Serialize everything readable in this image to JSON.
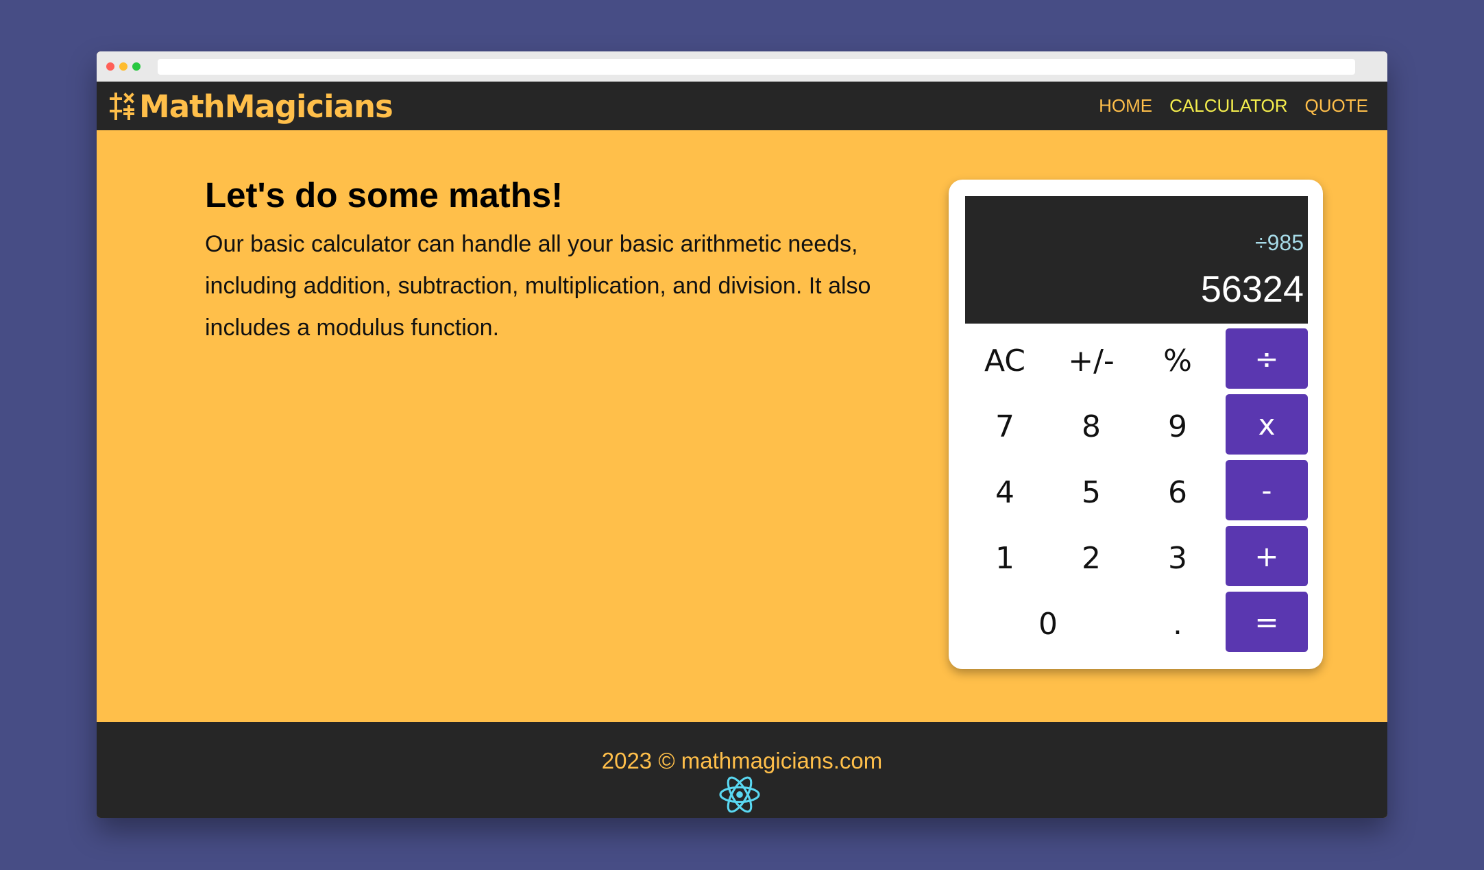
{
  "brand": {
    "name": "MathMagicians"
  },
  "nav": {
    "items": [
      {
        "label": "HOME",
        "active": false
      },
      {
        "label": "CALCULATOR",
        "active": true
      },
      {
        "label": "QUOTE",
        "active": false
      }
    ]
  },
  "main": {
    "heading": "Let's do some maths!",
    "description": "Our basic calculator can handle all your basic arithmetic needs, including addition, subtraction, multiplication, and division. It also includes a modulus function."
  },
  "calculator": {
    "display_operation": "÷985",
    "display_value": "56324",
    "keys": {
      "ac": "AC",
      "sign": "+/-",
      "percent": "%",
      "divide": "÷",
      "seven": "7",
      "eight": "8",
      "nine": "9",
      "multiply": "x",
      "four": "4",
      "five": "5",
      "six": "6",
      "subtract": "-",
      "one": "1",
      "two": "2",
      "three": "3",
      "add": "+",
      "zero": "0",
      "decimal": ".",
      "equals": "="
    }
  },
  "footer": {
    "text": "2023 © mathmagicians.com"
  },
  "colors": {
    "accent": "#ffbf4a",
    "dark": "#262626",
    "operator": "#5a37b0",
    "active_nav": "#f5ee4d",
    "background": "#474d85"
  },
  "icons": {
    "logo": "math-symbols-icon",
    "footer": "react-icon"
  }
}
